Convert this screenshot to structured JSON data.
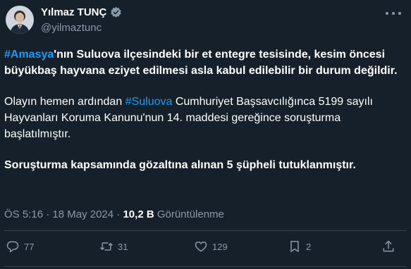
{
  "header": {
    "display_name": "Yılmaz TUNÇ",
    "handle": "@yilmaztunc",
    "verified_icon": "verified-badge-icon",
    "more_icon": "more-icon"
  },
  "body": {
    "p1_hashtag": "#Amasya",
    "p1_text": "'nın Suluova ilçesindeki bir et entegre tesisinde, kesim öncesi büyükbaş hayvana eziyet edilmesi asla kabul edilebilir bir durum değildir.",
    "p2_before": "Olayın hemen ardından ",
    "p2_hashtag": "#Suluova",
    "p2_after": " Cumhuriyet Başsavcılığınca 5199 sayılı Hayvanları Koruma Kanunu'nun 14. maddesi gereğince soruşturma başlatılmıştır.",
    "p3_text": "Soruşturma kapsamında gözaltına alınan 5 şüpheli tutuklanmıştır."
  },
  "meta": {
    "time": "ÖS 5:16",
    "separator": " · ",
    "date": "18 May 2024",
    "views_count": "10,2 B",
    "views_label": " Görüntülenme"
  },
  "actions": {
    "replies": "77",
    "retweets": "31",
    "likes": "129",
    "bookmarks": "2"
  },
  "colors": {
    "background": "#15202b",
    "accent": "#1d9bf0",
    "secondary_text": "#8b98a5",
    "divider": "#38444d"
  }
}
